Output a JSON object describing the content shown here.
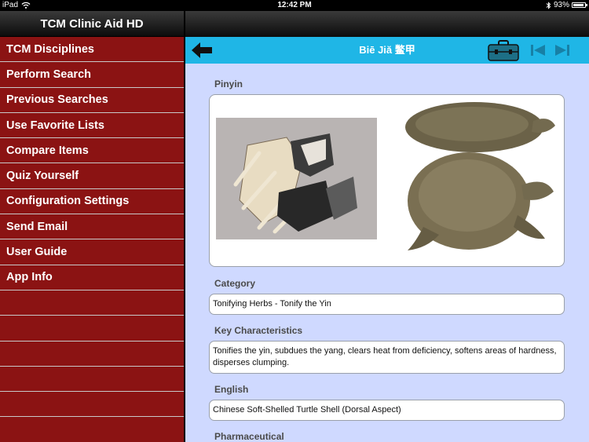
{
  "status_bar": {
    "device": "iPad",
    "time": "12:42 PM",
    "battery": "93%",
    "battery_level": 0.93
  },
  "sidebar": {
    "title": "TCM Clinic Aid HD",
    "items": [
      {
        "label": "TCM Disciplines"
      },
      {
        "label": "Perform Search"
      },
      {
        "label": "Previous Searches"
      },
      {
        "label": "Use Favorite Lists"
      },
      {
        "label": "Compare Items"
      },
      {
        "label": "Quiz Yourself"
      },
      {
        "label": "Configuration Settings"
      },
      {
        "label": "Send Email"
      },
      {
        "label": "User Guide"
      },
      {
        "label": "App Info"
      },
      {
        "label": ""
      },
      {
        "label": ""
      },
      {
        "label": ""
      },
      {
        "label": ""
      },
      {
        "label": ""
      },
      {
        "label": ""
      }
    ]
  },
  "navbar": {
    "title": "Biē Jiă 鳖甲",
    "icons": [
      "back-arrow-icon",
      "toolbox-icon",
      "first-record-icon",
      "last-record-icon"
    ]
  },
  "detail": {
    "pinyin_label": "Pinyin",
    "category_label": "Category",
    "category_value": "Tonifying Herbs - Tonify the Yin",
    "key_label": "Key Characteristics",
    "key_value": "Tonifies the yin, subdues the yang, clears heat from deficiency, softens areas of hardness, disperses clumping.",
    "english_label": "English",
    "english_value": "Chinese Soft-Shelled Turtle Shell (Dorsal Aspect)",
    "pharma_label": "Pharmaceutical"
  },
  "colors": {
    "sidebar_bg": "#8b1313",
    "navbar_bg": "#1fb6e6",
    "content_bg": "#cfd9ff",
    "toolbox": "#1d6f86"
  }
}
